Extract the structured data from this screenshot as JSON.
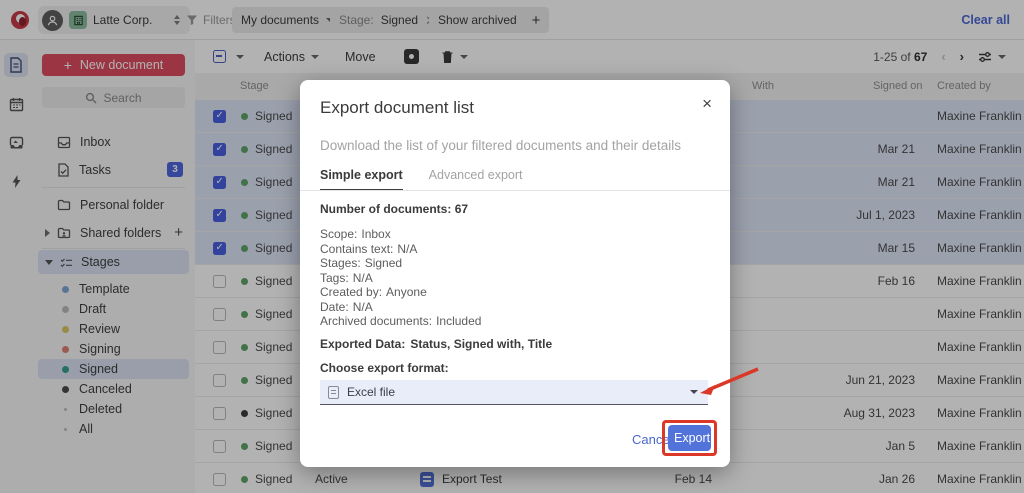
{
  "topbar": {
    "company_name": "Latte Corp.",
    "filters_label": "Filters:",
    "chip_my_documents": "My documents",
    "chip_stage_prefix": "Stage:",
    "chip_stage_value": "Signed",
    "chip_show_archived": "Show archived",
    "chip_add": "+",
    "clear_all": "Clear all"
  },
  "sidebar": {
    "new_document": "New document",
    "plus": "+",
    "search": "Search",
    "inbox": "Inbox",
    "tasks": "Tasks",
    "tasks_badge": "3",
    "personal_folder": "Personal folder",
    "shared_folders": "Shared folders",
    "add_folder": "+",
    "stages_header": "Stages",
    "stages": [
      {
        "label": "Template",
        "color": "#7fa8d9"
      },
      {
        "label": "Draft",
        "color": "#bcbcbc"
      },
      {
        "label": "Review",
        "color": "#d9c763"
      },
      {
        "label": "Signing",
        "color": "#de8174"
      },
      {
        "label": "Signed",
        "color": "#38a18c",
        "selected": true
      },
      {
        "label": "Canceled",
        "color": "#4b4b4b"
      },
      {
        "label": "Deleted",
        "color": "#bdbdbd",
        "small": true
      },
      {
        "label": "All",
        "color": "#bdbdbd",
        "small": true
      }
    ]
  },
  "toolbar": {
    "actions": "Actions",
    "move": "Move",
    "range": "1-25 of",
    "total": "67"
  },
  "table": {
    "columns": {
      "stage": "Stage",
      "with": "With",
      "signed_on": "Signed on",
      "created_by": "Created by"
    },
    "rows": [
      {
        "stage": "Signed",
        "dot": "#5fa468",
        "selected": true,
        "signed_on": "",
        "created_by": "Maxine Franklin"
      },
      {
        "stage": "Signed",
        "dot": "#5fa468",
        "selected": true,
        "signed_on": "Mar 21",
        "created_by": "Maxine Franklin"
      },
      {
        "stage": "Signed",
        "dot": "#5fa468",
        "selected": true,
        "signed_on": "Mar 21",
        "created_by": "Maxine Franklin"
      },
      {
        "stage": "Signed",
        "dot": "#5fa468",
        "selected": true,
        "signed_on": "Jul 1, 2023",
        "created_by": "Maxine Franklin"
      },
      {
        "stage": "Signed",
        "dot": "#5fa468",
        "selected": true,
        "signed_on": "Mar 15",
        "created_by": "Maxine Franklin"
      },
      {
        "stage": "Signed",
        "dot": "#5fa468",
        "selected": false,
        "signed_on": "Feb 16",
        "created_by": "Maxine Franklin"
      },
      {
        "stage": "Signed",
        "dot": "#5fa468",
        "selected": false,
        "signed_on": "",
        "created_by": "Maxine Franklin"
      },
      {
        "stage": "Signed",
        "dot": "#5fa468",
        "selected": false,
        "signed_on": "",
        "created_by": "Maxine Franklin"
      },
      {
        "stage": "Signed",
        "dot": "#5fa468",
        "selected": false,
        "signed_on": "Jun 21, 2023",
        "created_by": "Maxine Franklin"
      },
      {
        "stage": "Signed",
        "dot": "#3e3e3e",
        "selected": false,
        "signed_on": "Aug 31, 2023",
        "created_by": "Maxine Franklin"
      },
      {
        "stage": "Signed",
        "dot": "#5fa468",
        "selected": false,
        "signed_on": "Jan 5",
        "created_by": "Maxine Franklin"
      },
      {
        "stage": "Signed",
        "dot": "#5fa468",
        "selected": false,
        "signed_on": "Jan 26",
        "created_by": "Maxine Franklin",
        "status": "Active",
        "title": "Export Test",
        "date": "Feb 14"
      }
    ]
  },
  "modal": {
    "title": "Export document list",
    "close": "×",
    "subtitle": "Download the list of your filtered documents and their details",
    "tabs": [
      {
        "label": "Simple export"
      },
      {
        "label": "Advanced export"
      }
    ],
    "count_label": "Number of documents:",
    "count_value": "67",
    "details": [
      {
        "label": "Scope:",
        "value": "Inbox"
      },
      {
        "label": "Contains text:",
        "value": "N/A"
      },
      {
        "label": "Stages:",
        "value": "Signed"
      },
      {
        "label": "Tags:",
        "value": "N/A"
      },
      {
        "label": "Created by:",
        "value": "Anyone"
      },
      {
        "label": "Date:",
        "value": "N/A"
      },
      {
        "label": "Archived documents:",
        "value": "Included"
      }
    ],
    "exported_data_label": "Exported Data:",
    "exported_data_value": "Status, Signed with, Title",
    "format_label": "Choose export format:",
    "format_value": "Excel file",
    "cancel": "Cancel",
    "export": "Export"
  },
  "annotations": {
    "color": "#dc3828"
  }
}
